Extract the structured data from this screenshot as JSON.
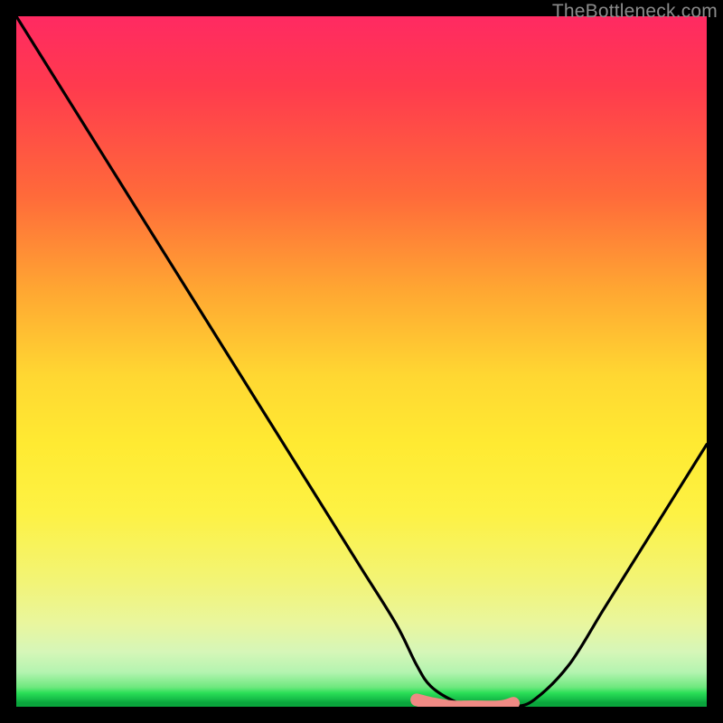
{
  "watermark": "TheBottleneck.com",
  "chart_data": {
    "type": "line",
    "title": "",
    "xlabel": "",
    "ylabel": "",
    "xlim": [
      0,
      100
    ],
    "ylim": [
      0,
      100
    ],
    "grid": false,
    "series": [
      {
        "name": "black-curve",
        "color": "#000000",
        "x": [
          0,
          5,
          10,
          15,
          20,
          25,
          30,
          35,
          40,
          45,
          50,
          55,
          58,
          60,
          63,
          66,
          70,
          72,
          75,
          80,
          85,
          90,
          95,
          100
        ],
        "y": [
          100,
          92,
          84,
          76,
          68,
          60,
          52,
          44,
          36,
          28,
          20,
          12,
          6,
          3,
          1,
          0,
          0,
          0,
          1,
          6,
          14,
          22,
          30,
          38
        ]
      },
      {
        "name": "pink-highlight",
        "color": "#ef8a84",
        "x": [
          58,
          60,
          63,
          66,
          70,
          72
        ],
        "y": [
          1,
          0.5,
          0,
          0,
          0,
          0.5
        ]
      }
    ],
    "annotations": []
  }
}
